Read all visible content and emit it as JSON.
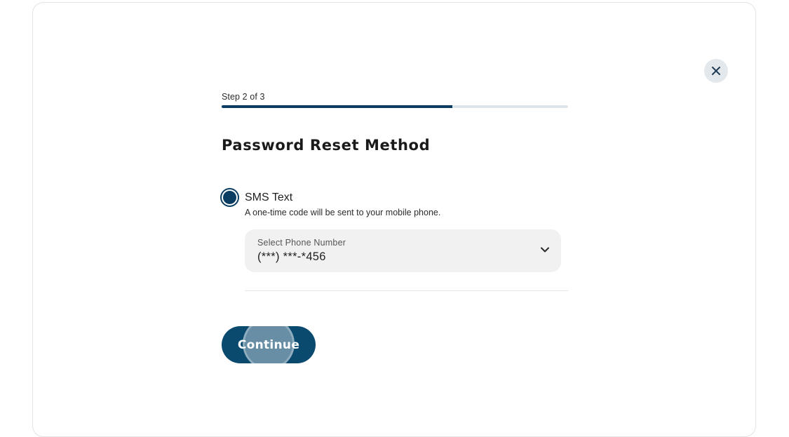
{
  "header": {
    "close_icon": "close-icon"
  },
  "progress": {
    "step_label": "Step 2 of 3",
    "current_step": 2,
    "total_steps": 3,
    "fraction_complete": 0.667,
    "fill_color": "#0b3d63",
    "track_color": "#dde5ec"
  },
  "page": {
    "title": "Password Reset Method"
  },
  "method_option": {
    "label": "SMS Text",
    "description": "A one-time code will be sent to your mobile phone.",
    "selected": true,
    "accent_color": "#0b3d63"
  },
  "phone_select": {
    "label": "Select Phone Number",
    "value": "(***) ***-*456",
    "icon": "chevron-down-icon"
  },
  "actions": {
    "continue_label": "Continue",
    "button_color": "#0b4a6f"
  }
}
